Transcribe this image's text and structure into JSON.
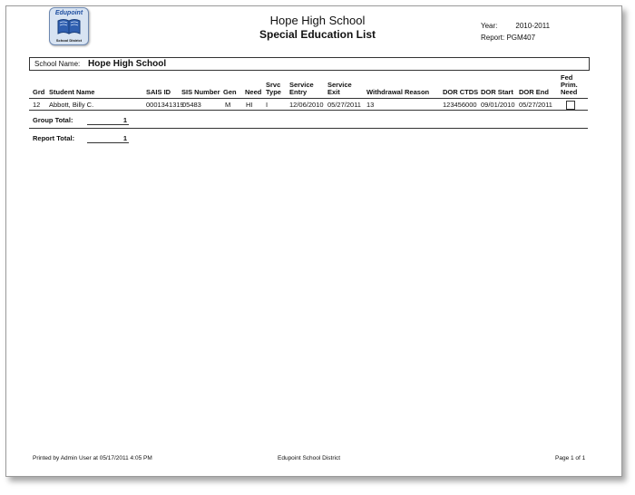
{
  "header": {
    "logo_brand": "Edupoint",
    "logo_sub": "School District",
    "school_title": "Hope High School",
    "report_title": "Special Education List",
    "year_label": "Year:",
    "year_value": "2010-2011",
    "report_label": "Report:",
    "report_value": "PGM407"
  },
  "school": {
    "label": "School Name:",
    "name": "Hope High School"
  },
  "columns": {
    "grd": "Grd",
    "student_name": "Student Name",
    "sais_id": "SAIS ID",
    "sis_number": "SIS Number",
    "gen": "Gen",
    "need": "Need",
    "srvc_type": [
      "Srvc",
      "Type"
    ],
    "service_entry": [
      "Service",
      "Entry"
    ],
    "service_exit": [
      "Service",
      "Exit"
    ],
    "withdrawal_reason": "Withdrawal Reason",
    "dor_ctds": "DOR CTDS",
    "dor_start": "DOR Start",
    "dor_end": "DOR End",
    "fed_prim_need": [
      "Fed",
      "Prim.",
      "Need"
    ]
  },
  "rows": [
    {
      "grd": "12",
      "student_name": "Abbott, Billy C.",
      "sais_id": "0001341319",
      "sis_number": "05483",
      "gen": "M",
      "need": "HI",
      "srvc_type": "I",
      "service_entry": "12/06/2010",
      "service_exit": "05/27/2011",
      "withdrawal_reason": "13",
      "dor_ctds": "123456000",
      "dor_start": "09/01/2010",
      "dor_end": "05/27/2011",
      "fed_prim_need_checked": false
    }
  ],
  "totals": {
    "group_label": "Group Total:",
    "group_value": "1",
    "report_label": "Report Total:",
    "report_value": "1"
  },
  "footer": {
    "printed_by": "Printed by Admin User at 05/17/2011 4:05 PM",
    "district": "Edupoint School District",
    "page": "Page 1 of 1"
  }
}
